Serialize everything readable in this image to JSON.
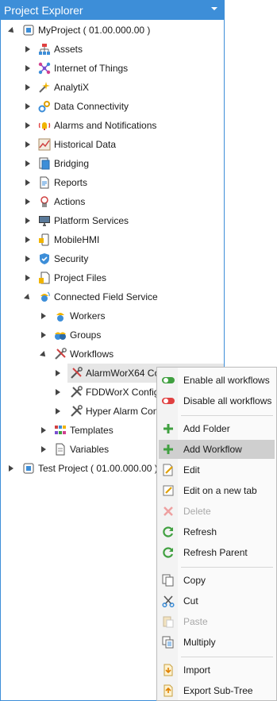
{
  "panel": {
    "title": "Project Explorer"
  },
  "tree": {
    "root": "MyProject ( 01.00.000.00 )",
    "items": [
      "Assets",
      "Internet of Things",
      "AnalytiX",
      "Data Connectivity",
      "Alarms and Notifications",
      "Historical Data",
      "Bridging",
      "Reports",
      "Actions",
      "Platform Services",
      "MobileHMI",
      "Security",
      "Project Files",
      "Connected Field Service"
    ],
    "cfs_children": [
      "Workers",
      "Groups",
      "Workflows"
    ],
    "workflows": [
      "AlarmWorX64 Co",
      "FDDWorX Config",
      "Hyper Alarm Con"
    ],
    "cfs_tail": [
      "Templates",
      "Variables"
    ],
    "second_root": "Test Project ( 01.00.000.00 )"
  },
  "context_menu": {
    "items": [
      "Enable all workflows",
      "Disable all workflows",
      "Add Folder",
      "Add Workflow",
      "Edit",
      "Edit on a new tab",
      "Delete",
      "Refresh",
      "Refresh Parent",
      "Copy",
      "Cut",
      "Paste",
      "Multiply",
      "Import",
      "Export Sub-Tree"
    ]
  },
  "colors": {
    "accent": "#3d8ed8",
    "highlight": "#cfcfcf"
  }
}
